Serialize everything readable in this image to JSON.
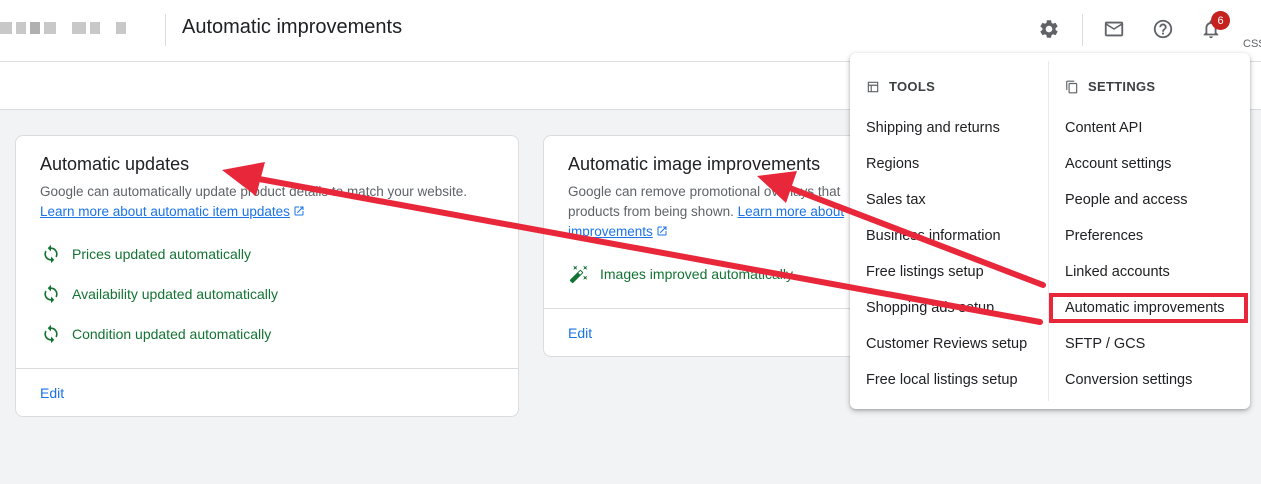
{
  "header": {
    "title": "Automatic improvements",
    "notification_count": "6",
    "account_label": "CSS"
  },
  "cards": {
    "updates": {
      "title": "Automatic updates",
      "description": "Google can automatically update product details to match your website.",
      "link_text": "Learn more about automatic item updates",
      "statuses": [
        "Prices updated automatically",
        "Availability updated automatically",
        "Condition updated automatically"
      ],
      "edit_label": "Edit"
    },
    "images": {
      "title": "Automatic image improvements",
      "description_line1": "Google can remove promotional overlays that",
      "description_line2": "products from being shown.",
      "link_text_1": "Learn more about",
      "link_text_2": "improvements",
      "status": "Images improved automatically",
      "edit_label": "Edit"
    }
  },
  "menu": {
    "tools": {
      "heading": "TOOLS",
      "items": [
        "Shipping and returns",
        "Regions",
        "Sales tax",
        "Business information",
        "Free listings setup",
        "Shopping ads setup",
        "Customer Reviews setup",
        "Free local listings setup"
      ]
    },
    "settings": {
      "heading": "SETTINGS",
      "items": [
        "Content API",
        "Account settings",
        "People and access",
        "Preferences",
        "Linked accounts",
        "Automatic improvements",
        "SFTP / GCS",
        "Conversion settings"
      ],
      "highlighted": "Automatic improvements"
    }
  },
  "colors": {
    "status_green": "#137333",
    "link_blue": "#1a73e8",
    "annotation_red": "#e8283a",
    "badge_red": "#c5221f"
  },
  "icons": {
    "settings": "gear-icon",
    "mail": "mail-icon",
    "help": "help-icon",
    "notifications": "bell-icon",
    "status": "sync-icon",
    "image_status": "magic-wand-icon",
    "tools": "tools-icon",
    "settings_menu": "settings-copy-icon"
  }
}
